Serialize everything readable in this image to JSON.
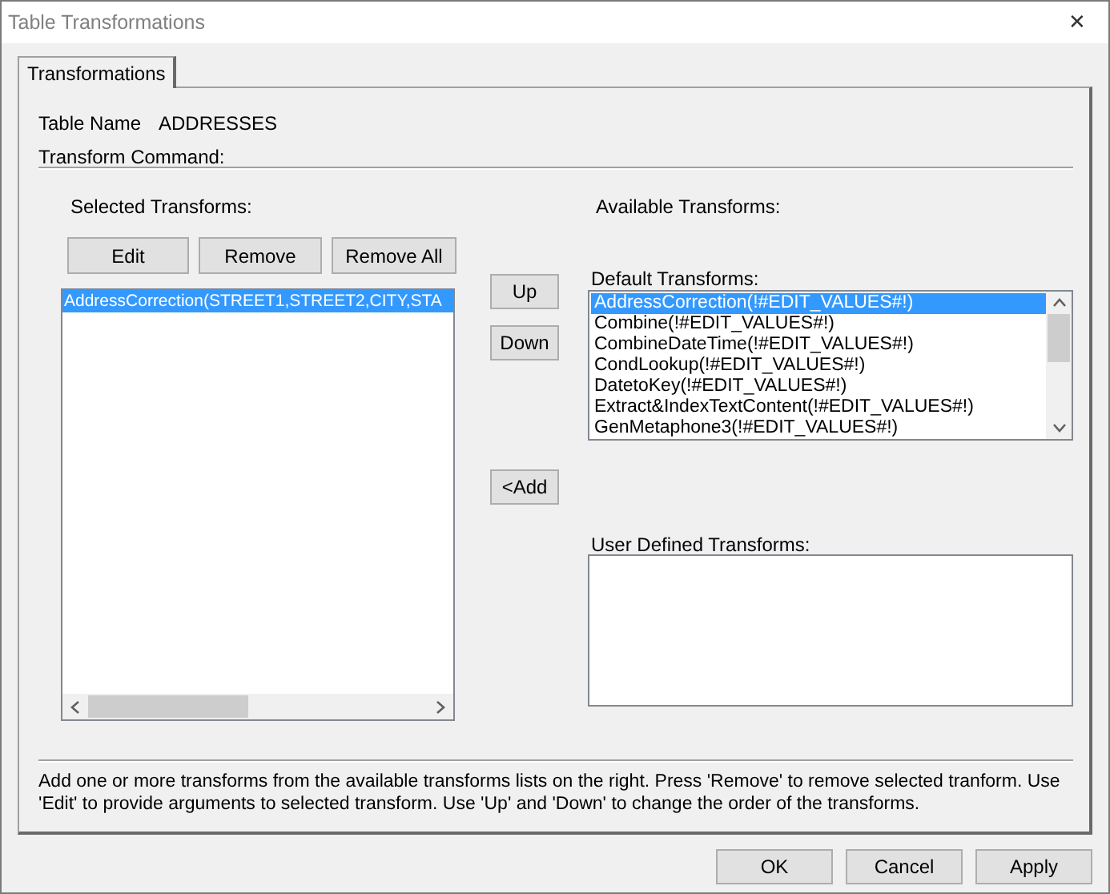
{
  "window": {
    "title": "Table Transformations",
    "close": "✕"
  },
  "tabs": [
    {
      "label": "Transformations",
      "selected": true
    }
  ],
  "table_name": {
    "label": "Table Name",
    "value": "ADDRESSES"
  },
  "transform_command": {
    "label": "Transform Command:"
  },
  "selected_transforms": {
    "label": "Selected Transforms:",
    "buttons": [
      "Edit",
      "Remove",
      "Remove All"
    ],
    "items": [
      {
        "text": "AddressCorrection(STREET1,STREET2,CITY,STA",
        "selected": true
      }
    ]
  },
  "order_buttons": [
    "Up",
    "Down"
  ],
  "add_button": "<Add",
  "available_transforms": {
    "label": "Available Transforms:"
  },
  "default_transforms": {
    "label": "Default Transforms:",
    "items": [
      {
        "text": "AddressCorrection(!#EDIT_VALUES#!)",
        "selected": true
      },
      {
        "text": "Combine(!#EDIT_VALUES#!)",
        "selected": false
      },
      {
        "text": "CombineDateTime(!#EDIT_VALUES#!)",
        "selected": false
      },
      {
        "text": "CondLookup(!#EDIT_VALUES#!)",
        "selected": false
      },
      {
        "text": "DatetoKey(!#EDIT_VALUES#!)",
        "selected": false
      },
      {
        "text": "Extract&IndexTextContent(!#EDIT_VALUES#!)",
        "selected": false
      },
      {
        "text": "GenMetaphone3(!#EDIT_VALUES#!)",
        "selected": false
      }
    ]
  },
  "user_defined_transforms": {
    "label": "User Defined Transforms:"
  },
  "help_text": "Add one or more transforms from the available transforms lists on the right. Press 'Remove' to remove selected tranform. Use 'Edit' to provide arguments to selected transform. Use 'Up' and 'Down' to change the order of the transforms.",
  "dialog_buttons": [
    "OK",
    "Cancel",
    "Apply"
  ]
}
